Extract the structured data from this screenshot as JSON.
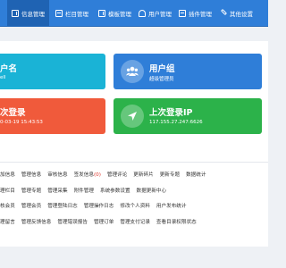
{
  "nav": {
    "items": [
      {
        "label": "信息管理",
        "icon": "edit-icon",
        "active": true
      },
      {
        "label": "栏目管理",
        "icon": "grid-icon",
        "active": false
      },
      {
        "label": "模板管理",
        "icon": "edit-icon",
        "active": false
      },
      {
        "label": "用户管理",
        "icon": "user-icon",
        "active": false
      },
      {
        "label": "插件管理",
        "icon": "grid-icon",
        "active": false
      },
      {
        "label": "其他设置",
        "icon": "wrench-icon",
        "active": false
      }
    ]
  },
  "cards": {
    "username": {
      "title": "户名",
      "sub": "ell"
    },
    "usergroup": {
      "title": "用户组",
      "sub": "超级管理员",
      "icon": "users-icon"
    },
    "last_login_time": {
      "title": "次登录",
      "sub": "0-03-19 15:43:53"
    },
    "last_login_ip": {
      "title": "上次登录IP",
      "sub": "117.155.27.247:6626",
      "icon": "location-arrow-icon"
    }
  },
  "colors": {
    "nav_bg": "#2f7ed8",
    "card_cyan": "#1ab3d6",
    "card_blue": "#2f7ed8",
    "card_red": "#f05a3b",
    "card_green": "#2cb24a",
    "badge_red": "#e0352b"
  },
  "quick_links": {
    "row1": [
      "加信息",
      "管理信息",
      "审核信息",
      "签发信息",
      "(0)",
      "管理评论",
      "更新碎片",
      "更新专题",
      "数据统计"
    ],
    "row2": [
      "理栏目",
      "管理专题",
      "管理采集",
      "附件管理",
      "系统参数设置",
      "数据更新中心"
    ],
    "row3": [
      "核会员",
      "管理会员",
      "管理登陆日志",
      "管理操作日志",
      "修改个人资料",
      "用户发布统计"
    ],
    "row4": [
      "理留言",
      "管理反馈信息",
      "管理错误报告",
      "管理订单",
      "管理支付记录",
      "查看目录权限状态"
    ]
  }
}
